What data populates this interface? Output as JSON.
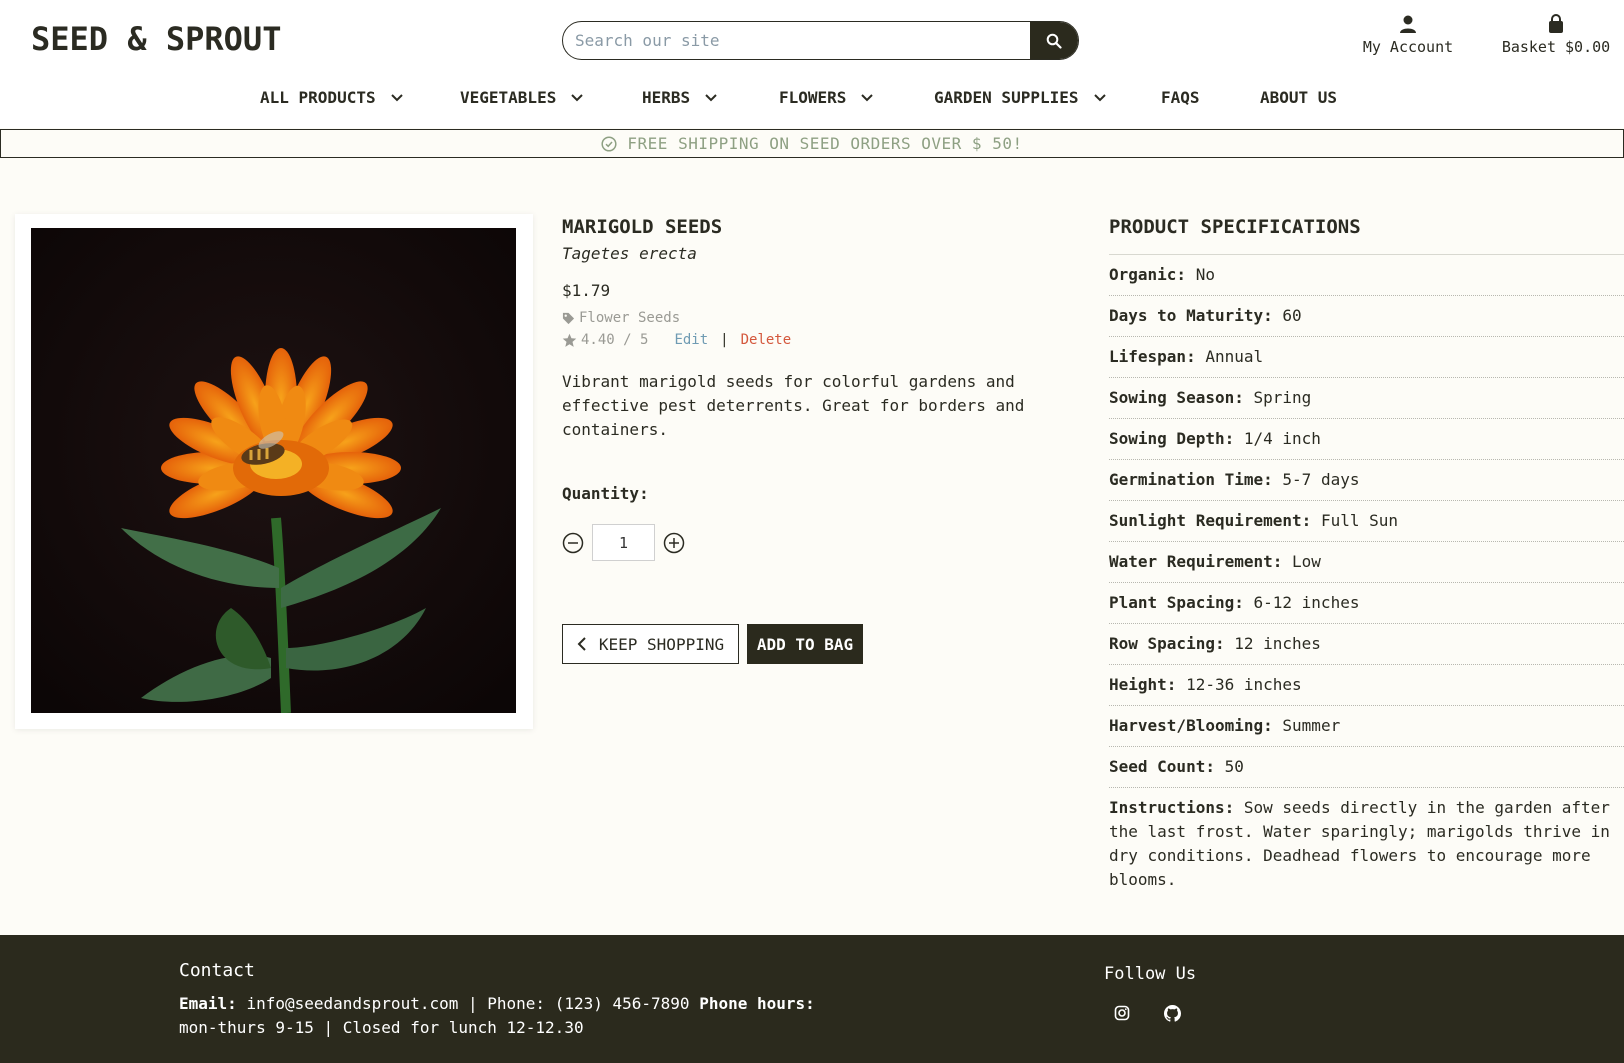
{
  "header": {
    "logo": "SEED & SPROUT",
    "search_placeholder": "Search our site",
    "account_label": "My Account",
    "basket_label": "Basket $0.00"
  },
  "nav": {
    "items": [
      {
        "label": "ALL PRODUCTS",
        "dropdown": true
      },
      {
        "label": "VEGETABLES",
        "dropdown": true
      },
      {
        "label": "HERBS",
        "dropdown": true
      },
      {
        "label": "FLOWERS",
        "dropdown": true
      },
      {
        "label": "GARDEN SUPPLIES",
        "dropdown": true
      },
      {
        "label": "FAQS",
        "dropdown": false
      },
      {
        "label": "ABOUT US",
        "dropdown": false
      }
    ]
  },
  "banner": {
    "text": "FREE SHIPPING ON SEED ORDERS OVER $ 50!",
    "icon": "check-circle-icon"
  },
  "product": {
    "title": "MARIGOLD SEEDS",
    "scientific_name": "Tagetes erecta",
    "price": "$1.79",
    "category": "Flower Seeds",
    "rating": "4.40 / 5",
    "edit_label": "Edit",
    "separator": "|",
    "delete_label": "Delete",
    "description": "Vibrant marigold seeds for colorful gardens and effective pest deterrents. Great for borders and containers.",
    "quantity_label": "Quantity:",
    "quantity_value": "1",
    "keep_shopping_label": "KEEP SHOPPING",
    "add_to_bag_label": "ADD TO BAG"
  },
  "specs": {
    "title": "PRODUCT SPECIFICATIONS",
    "rows": [
      {
        "key": "Organic:",
        "value": "No"
      },
      {
        "key": "Days to Maturity:",
        "value": "60"
      },
      {
        "key": "Lifespan:",
        "value": "Annual"
      },
      {
        "key": "Sowing Season:",
        "value": "Spring"
      },
      {
        "key": "Sowing Depth:",
        "value": "1/4 inch"
      },
      {
        "key": "Germination Time:",
        "value": "5-7 days"
      },
      {
        "key": "Sunlight Requirement:",
        "value": "Full Sun"
      },
      {
        "key": "Water Requirement:",
        "value": "Low"
      },
      {
        "key": "Plant Spacing:",
        "value": "6-12 inches"
      },
      {
        "key": "Row Spacing:",
        "value": "12 inches"
      },
      {
        "key": "Height:",
        "value": "12-36 inches"
      },
      {
        "key": "Harvest/Blooming:",
        "value": "Summer"
      },
      {
        "key": "Seed Count:",
        "value": "50"
      },
      {
        "key": "Instructions:",
        "value": "Sow seeds directly in the garden after the last frost. Water sparingly; marigolds thrive in dry conditions. Deadhead flowers to encourage more blooms."
      }
    ]
  },
  "footer": {
    "contact_title": "Contact",
    "email_label": "Email:",
    "email_value": "info@seedandsprout.com | Phone: (123) 456-7890",
    "hours_label": "Phone hours:",
    "hours_value": "mon-thurs 9-15 | Closed for lunch 12-12.30",
    "follow_title": "Follow Us",
    "social": [
      "instagram-icon",
      "github-icon"
    ]
  },
  "colors": {
    "dark": "#2b2a1d",
    "banner_text": "#8ea083",
    "edit_link": "#6f9bb3",
    "delete_link": "#d4573c",
    "page_bg": "#fdfcf7"
  }
}
